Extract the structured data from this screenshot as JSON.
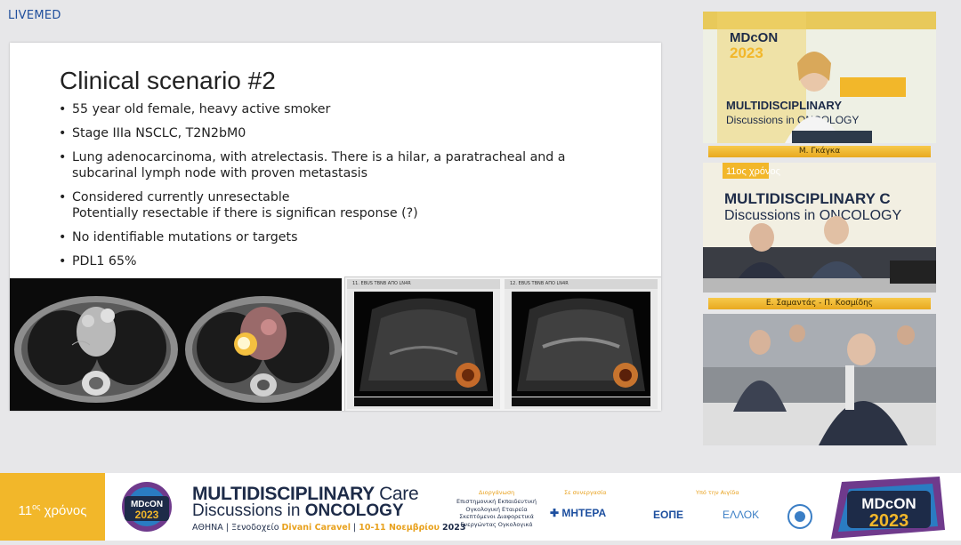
{
  "brand": {
    "live": "LIVE",
    "med": "MED"
  },
  "slide": {
    "title": "Clinical scenario #2",
    "bullets": [
      "55 year old female, heavy active smoker",
      "Stage IIIa  NSCLC, T2N2bM0",
      "Lung adenocarcinoma, with atrelectasis.  There is a hilar, a paratracheal and a subcarinal lymph node with proven metastasis",
      "Considered  currently unresectable\nPotentially resectable if there is significan response (?)",
      "No identifiable mutations or targets",
      "PDL1 65%"
    ],
    "us_labels": [
      "11. EBUS TBNB ΑΠΟ LN4R",
      "12. EBUS TBNB ΑΠΟ LN4R"
    ]
  },
  "speakers": {
    "cam1_name": "Μ. Γκάγκα",
    "cam2_name": "Ε. Σαμαντάς - Π. Κοσμίδης"
  },
  "banner": {
    "years": "11",
    "years_sup": "ος",
    "years_word": "χρόνος",
    "mdcon": "MDcON",
    "year": "2023",
    "title_bold": "MULTIDISCIPLINARY",
    "title_rest": "Care",
    "subtitle_pre": "Discussions in",
    "subtitle_bold": "ONCOLOGY",
    "venue_city": "ΑΘΗΝΑ",
    "venue_hotel": "Ξενοδοχείο",
    "venue_name": "Divani Caravel",
    "dates": "10-11 Νοεμβρίου",
    "dates_year": "2023",
    "organizer_label": "Διοργάνωση",
    "organizer_text": "Επιστημονική Εκπαιδευτική Ογκολογική Εταιρεία Σκεπτόμενοι Διαφορετικά Ενεργώντας Ογκολογικά",
    "partner_label": "Σε συνεργασία",
    "partner": "ΜΗΤΕΡΑ",
    "auspices_label": "Υπό την Αιγίδα",
    "auspice1": "ΕΟΠΕ",
    "auspice2": "ΕΛΛΟΚ"
  },
  "colors": {
    "accent": "#f2b72a",
    "navy": "#1d2b48",
    "blue": "#1d4f9f"
  }
}
